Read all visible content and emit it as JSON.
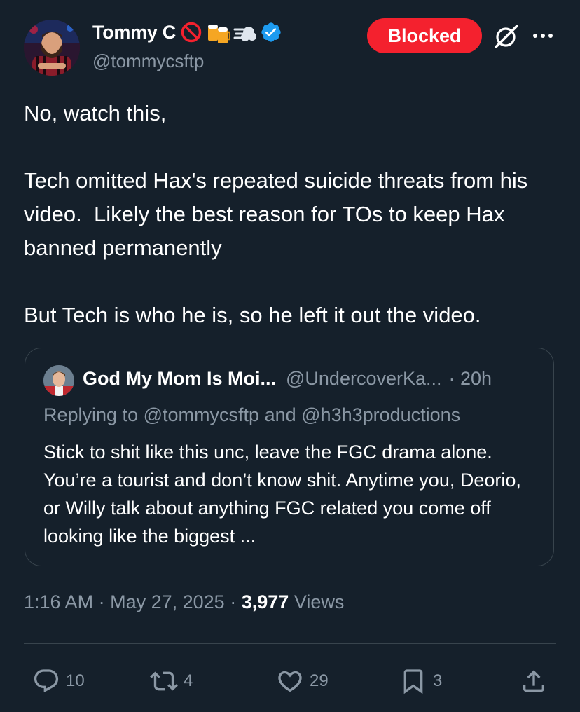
{
  "author": {
    "name": "Tommy C",
    "handle": "@tommycsftp",
    "icons": [
      "no-entry-icon",
      "beer-mugs-icon",
      "dash-icon",
      "verified-badge-icon"
    ]
  },
  "header": {
    "blocked_label": "Blocked",
    "grok_icon": "grok-icon",
    "more_icon": "more-icon"
  },
  "tweet": {
    "paragraphs": [
      "No, watch this,",
      "Tech omitted Hax's repeated suicide threats from his video.  Likely the best reason for TOs to keep Hax banned permanently",
      "But Tech is who he is, so he left it out the video."
    ]
  },
  "quote": {
    "name": "God My Mom Is Moi...",
    "handle": "@UndercoverKa...",
    "time": "· 20h",
    "reply_prefix": "Replying to",
    "reply_to_1": "@tommycsftp",
    "reply_and": "and",
    "reply_to_2": "@h3h3productions",
    "text": "Stick to shit like this unc, leave the FGC drama alone. You’re a tourist and don’t know shit. Anytime you, Deorio, or Willy talk about anything FGC related you come off looking like the biggest ..."
  },
  "meta": {
    "time": "1:16 AM",
    "sep1": "·",
    "date": "May 27, 2025",
    "sep2": "·",
    "views_count": "3,977",
    "views_label": "Views"
  },
  "actions": {
    "replies": "10",
    "reposts": "4",
    "likes": "29",
    "bookmarks": "3"
  },
  "colors": {
    "background": "#15202b",
    "secondary_text": "#8b98a5",
    "border": "#38444d",
    "blocked": "#f4212e",
    "verified": "#1d9bf0"
  }
}
